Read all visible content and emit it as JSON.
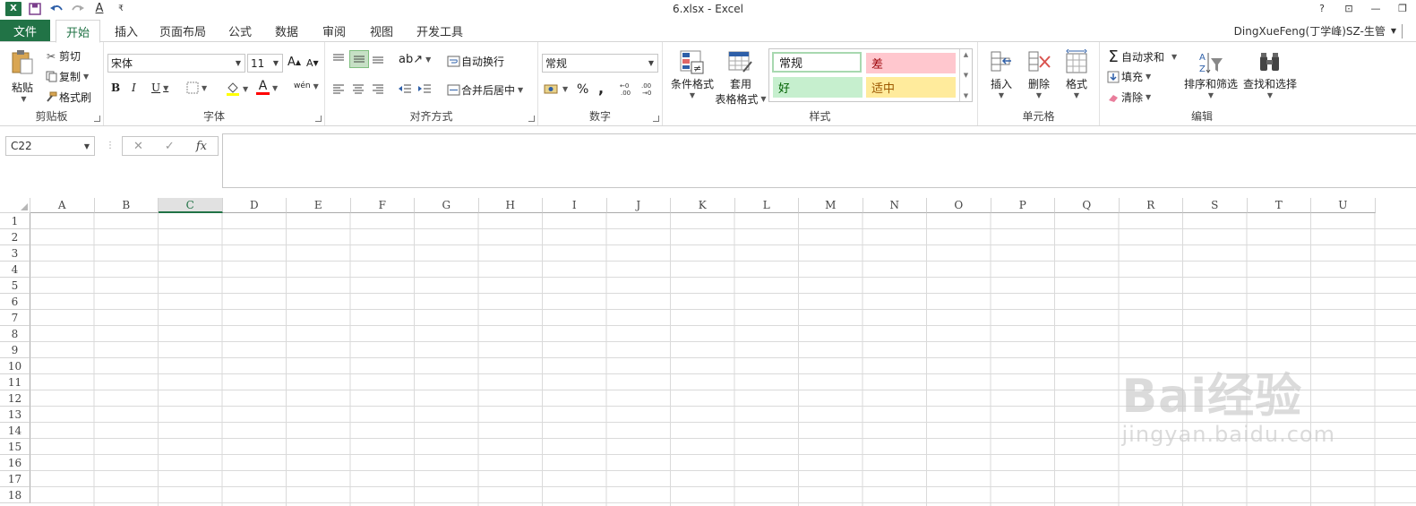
{
  "window": {
    "title": "6.xlsx - Excel",
    "help_glyph": "?",
    "ribbon_display_glyph": "⊡",
    "minimize_glyph": "—",
    "restore_glyph": "❐"
  },
  "qat": {
    "app_icon": "excel-icon",
    "app_glyph": "X",
    "save_icon": "save-icon",
    "undo_icon": "undo-icon",
    "redo_icon": "redo-icon",
    "font_color_icon": "font-color-icon",
    "font_color_letter": "A",
    "customize_glyph": "₹"
  },
  "tabs": {
    "file": "文件",
    "items": [
      "开始",
      "插入",
      "页面布局",
      "公式",
      "数据",
      "审阅",
      "视图",
      "开发工具"
    ],
    "active": "开始",
    "user": "DingXueFeng(丁学峰)SZ-生管"
  },
  "ribbon": {
    "clipboard": {
      "label": "剪贴板",
      "paste": "粘贴",
      "cut": "剪切",
      "copy": "复制",
      "format_painter": "格式刷"
    },
    "font": {
      "label": "字体",
      "font_name": "宋体",
      "font_size": "11",
      "bold": "B",
      "italic": "I",
      "underline": "U",
      "grow": "A",
      "shrink": "A",
      "font_color": "A",
      "phonetic": "wén"
    },
    "alignment": {
      "label": "对齐方式",
      "wrap_text": "自动换行",
      "merge_center": "合并后居中"
    },
    "number": {
      "label": "数字",
      "format": "常规",
      "percent": "%",
      "comma": ","
    },
    "styles": {
      "label": "样式",
      "conditional_format": "条件格式",
      "table_format_1": "套用",
      "table_format_2": "表格格式",
      "normal": "常规",
      "bad": "差",
      "good": "好",
      "neutral": "适中",
      "colors": {
        "bad_bg": "#ffc7ce",
        "bad_fg": "#9c0006",
        "good_bg": "#c6efce",
        "good_fg": "#006100",
        "neutral_bg": "#ffeb9c",
        "neutral_fg": "#9c5700"
      }
    },
    "cells": {
      "label": "单元格",
      "insert": "插入",
      "delete": "删除",
      "format": "格式"
    },
    "editing": {
      "label": "编辑",
      "autosum": "自动求和",
      "fill": "填充",
      "clear": "清除",
      "sort_filter": "排序和筛选",
      "find_select": "查找和选择"
    }
  },
  "formula_bar": {
    "name_box": "C22",
    "fx": "fx",
    "value": ""
  },
  "grid": {
    "columns": [
      "A",
      "B",
      "C",
      "D",
      "E",
      "F",
      "G",
      "H",
      "I",
      "J",
      "K",
      "L",
      "M",
      "N",
      "O",
      "P",
      "Q",
      "R",
      "S",
      "T",
      "U"
    ],
    "rows": [
      "1",
      "2",
      "3",
      "4",
      "5",
      "6",
      "7",
      "8",
      "9",
      "10",
      "11",
      "12",
      "13",
      "14",
      "15",
      "16",
      "17",
      "18"
    ],
    "selected_column": "C"
  },
  "watermark": {
    "brand": "Bai经验",
    "url": "jingyan.baidu.com"
  },
  "accent": "#217346"
}
